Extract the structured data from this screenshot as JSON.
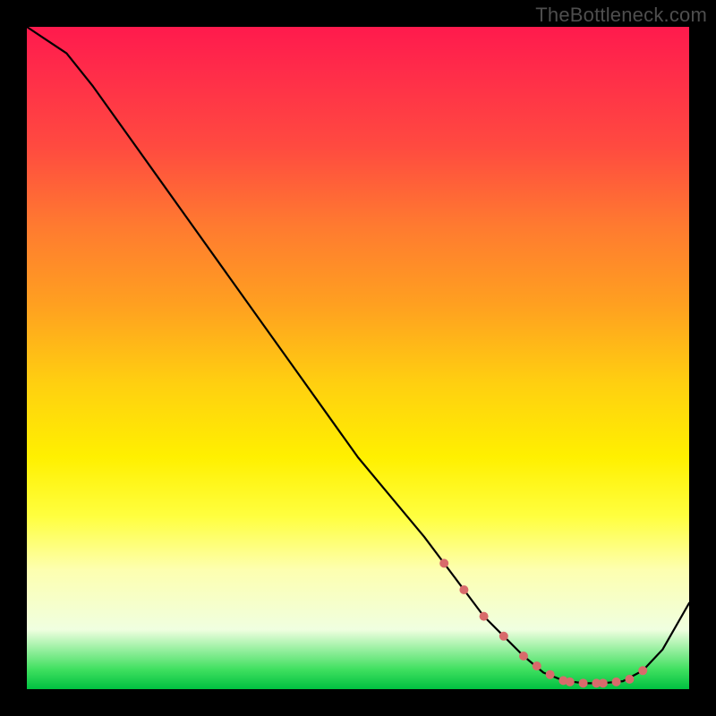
{
  "watermark": "TheBottleneck.com",
  "colors": {
    "background": "#000000",
    "gradient_top": "#ff1a4d",
    "gradient_bottom": "#00c040",
    "curve": "#000000",
    "marker": "#d86b6b"
  },
  "chart_data": {
    "type": "line",
    "title": "",
    "xlabel": "",
    "ylabel": "",
    "xlim": [
      0,
      100
    ],
    "ylim": [
      0,
      100
    ],
    "x": [
      0,
      3,
      6,
      10,
      15,
      20,
      25,
      30,
      35,
      40,
      45,
      50,
      55,
      60,
      63,
      66,
      69,
      72,
      75,
      78,
      81,
      84,
      87,
      90,
      93,
      96,
      100
    ],
    "y": [
      100,
      98,
      96,
      91,
      84,
      77,
      70,
      63,
      56,
      49,
      42,
      35,
      29,
      23,
      19,
      15,
      11,
      8,
      5,
      2.5,
      1.3,
      0.9,
      0.9,
      1.2,
      2.8,
      6,
      13
    ],
    "markers": {
      "x": [
        63,
        66,
        69,
        72,
        75,
        77,
        79,
        81,
        82,
        84,
        86,
        87,
        89,
        91,
        93
      ],
      "y": [
        19,
        15,
        11,
        8,
        5,
        3.5,
        2.2,
        1.3,
        1.1,
        0.9,
        0.9,
        0.9,
        1.1,
        1.5,
        2.8
      ]
    }
  }
}
